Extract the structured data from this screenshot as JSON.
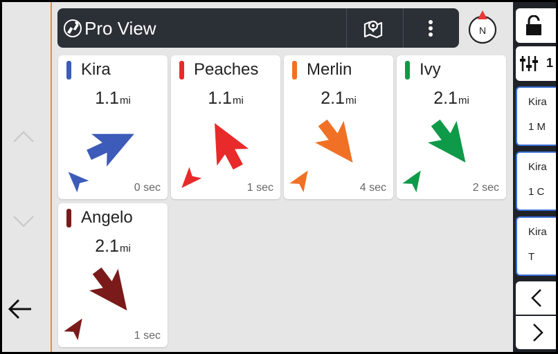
{
  "app": {
    "title": "Pro View"
  },
  "header": {
    "title": "Pro View",
    "logo_icon": "dog-runner-icon",
    "map_icon": "map-pin-icon",
    "menu_icon": "more-vertical-icon"
  },
  "compass": {
    "label": "N",
    "needle_color": "#e53935"
  },
  "left_rail": {
    "up_icon": "chevron-up-icon",
    "down_icon": "chevron-down-icon",
    "back_icon": "arrow-left-icon",
    "accent_color": "#ef8b33"
  },
  "dogs": [
    {
      "name": "Kira",
      "distance": "1.1",
      "unit": "mi",
      "time": "0 sec",
      "color": "#3d5bb8",
      "heading_deg": 65
    },
    {
      "name": "Peaches",
      "distance": "1.1",
      "unit": "mi",
      "time": "1 sec",
      "color": "#e82a2a",
      "heading_deg": -28
    },
    {
      "name": "Merlin",
      "distance": "2.1",
      "unit": "mi",
      "time": "4 sec",
      "color": "#f07125",
      "heading_deg": 143
    },
    {
      "name": "Ivy",
      "distance": "2.1",
      "unit": "mi",
      "time": "2 sec",
      "color": "#0e9a48",
      "heading_deg": 143
    },
    {
      "name": "Angelo",
      "distance": "2.1",
      "unit": "mi",
      "time": "1 sec",
      "color": "#7a1a1a",
      "heading_deg": 143
    }
  ],
  "right_panel": {
    "lock_icon": "unlock-icon",
    "filter_icon": "sliders-icon",
    "filter_count": "1",
    "tiles": [
      {
        "line1": "Kira",
        "line2": "1  M"
      },
      {
        "line1": "Kira",
        "line2": "1  C"
      },
      {
        "line1": "Kira",
        "line2": "T"
      }
    ],
    "prev_icon": "chevron-left-icon",
    "next_icon": "chevron-right-icon"
  }
}
